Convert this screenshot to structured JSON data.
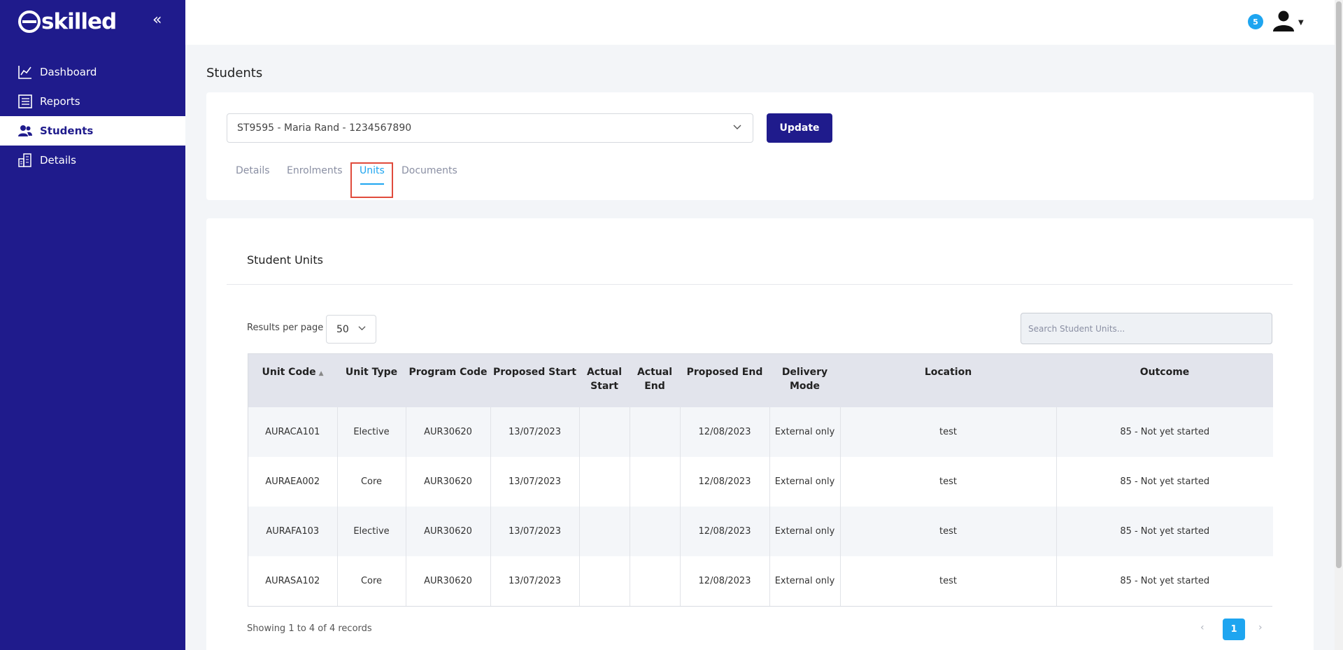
{
  "brand": {
    "logo_text": "skilled"
  },
  "sidebar": {
    "items": [
      {
        "label": "Dashboard",
        "icon": "chart-line-icon"
      },
      {
        "label": "Reports",
        "icon": "report-list-icon"
      },
      {
        "label": "Students",
        "icon": "users-icon",
        "active": true
      },
      {
        "label": "Details",
        "icon": "building-icon"
      }
    ]
  },
  "topbar": {
    "notification_count": "5"
  },
  "page": {
    "title": "Students"
  },
  "student_select": {
    "value": "ST9595 - Maria Rand - 1234567890"
  },
  "update_label": "Update",
  "tabs": [
    {
      "label": "Details"
    },
    {
      "label": "Enrolments"
    },
    {
      "label": "Units",
      "active": true
    },
    {
      "label": "Documents"
    }
  ],
  "units_card": {
    "title": "Student Units",
    "results_per_page_label": "Results per page",
    "results_per_page_value": "50",
    "search_placeholder": "Search Student Units..."
  },
  "table": {
    "columns": [
      "Unit Code",
      "Unit Type",
      "Program Code",
      "Proposed Start",
      "Actual Start",
      "Actual End",
      "Proposed End",
      "Delivery Mode",
      "Location",
      "Outcome"
    ],
    "rows": [
      [
        "AURACA101",
        "Elective",
        "AUR30620",
        "13/07/2023",
        "",
        "",
        "12/08/2023",
        "External only",
        "test",
        "85 - Not yet started"
      ],
      [
        "AURAEA002",
        "Core",
        "AUR30620",
        "13/07/2023",
        "",
        "",
        "12/08/2023",
        "External only",
        "test",
        "85 - Not yet started"
      ],
      [
        "AURAFA103",
        "Elective",
        "AUR30620",
        "13/07/2023",
        "",
        "",
        "12/08/2023",
        "External only",
        "test",
        "85 - Not yet started"
      ],
      [
        "AURASA102",
        "Core",
        "AUR30620",
        "13/07/2023",
        "",
        "",
        "12/08/2023",
        "External only",
        "test",
        "85 - Not yet started"
      ]
    ]
  },
  "pagination": {
    "summary": "Showing 1 to 4 of 4 records",
    "current_page": "1"
  },
  "colors": {
    "sidebar": "#1f1b8c",
    "accent": "#1ea5f0",
    "highlight_border": "#e04b3c"
  }
}
